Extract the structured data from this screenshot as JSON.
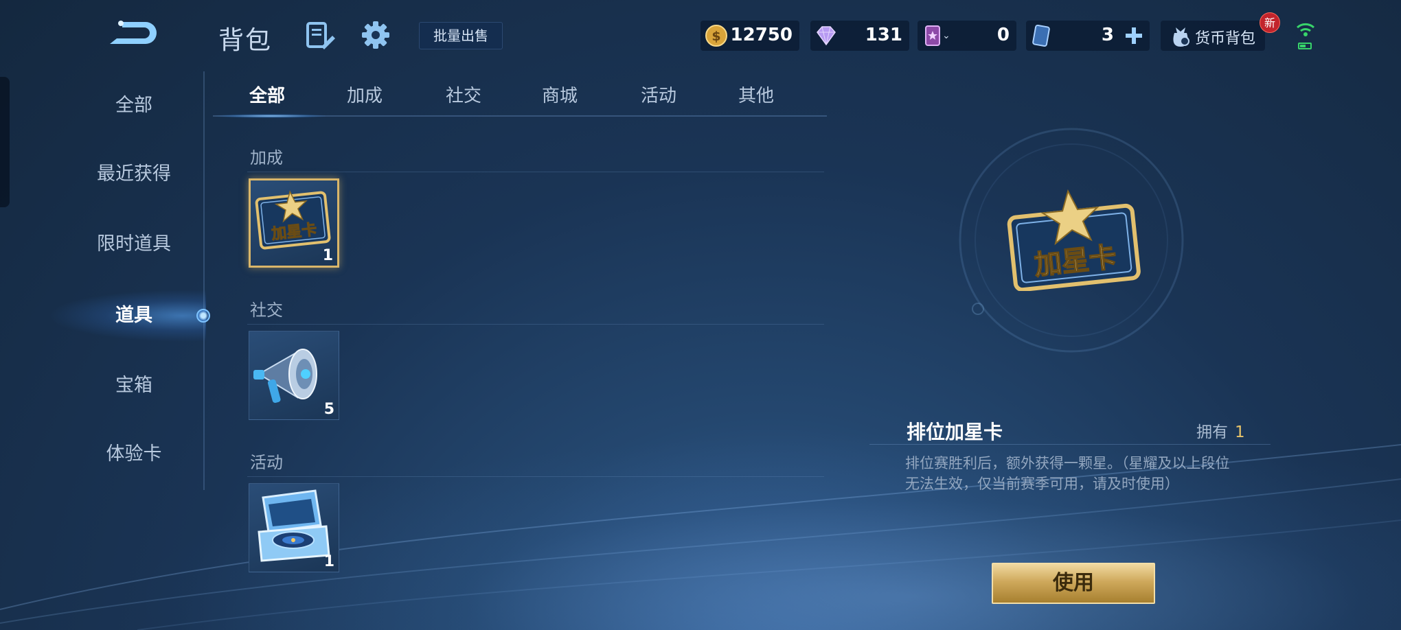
{
  "header": {
    "title": "背包",
    "batch_sell_label": "批量出售",
    "gold": "12750",
    "diamonds": "131",
    "tickets": "0",
    "cards": "3",
    "wallet_label": "货币背包",
    "new_badge": "新"
  },
  "sidebar": {
    "items": [
      {
        "label": "全部"
      },
      {
        "label": "最近获得"
      },
      {
        "label": "限时道具"
      },
      {
        "label": "道具"
      },
      {
        "label": "宝箱"
      },
      {
        "label": "体验卡"
      }
    ],
    "active_index": 3
  },
  "tabs": [
    {
      "label": "全部"
    },
    {
      "label": "加成"
    },
    {
      "label": "社交"
    },
    {
      "label": "商城"
    },
    {
      "label": "活动"
    },
    {
      "label": "其他"
    }
  ],
  "sections": [
    {
      "title": "加成",
      "items": [
        {
          "icon": "rank-star-card-icon",
          "count": "1",
          "selected": true
        }
      ]
    },
    {
      "title": "社交",
      "items": [
        {
          "icon": "megaphone-icon",
          "count": "5"
        }
      ]
    },
    {
      "title": "活动",
      "items": [
        {
          "icon": "record-gift-box-icon",
          "count": "1"
        }
      ]
    }
  ],
  "card_text": "加星卡",
  "detail": {
    "name": "排位加星卡",
    "owned_label": "拥有",
    "owned_count": "1",
    "description": "排位赛胜利后，额外获得一颗星。（星耀及以上段位无法生效，仅当前赛季可用，请及时使用）",
    "use_label": "使用"
  },
  "colors": {
    "accent_gold": "#d9b66a",
    "background": "#1a3455",
    "new_badge": "#c2242c"
  }
}
